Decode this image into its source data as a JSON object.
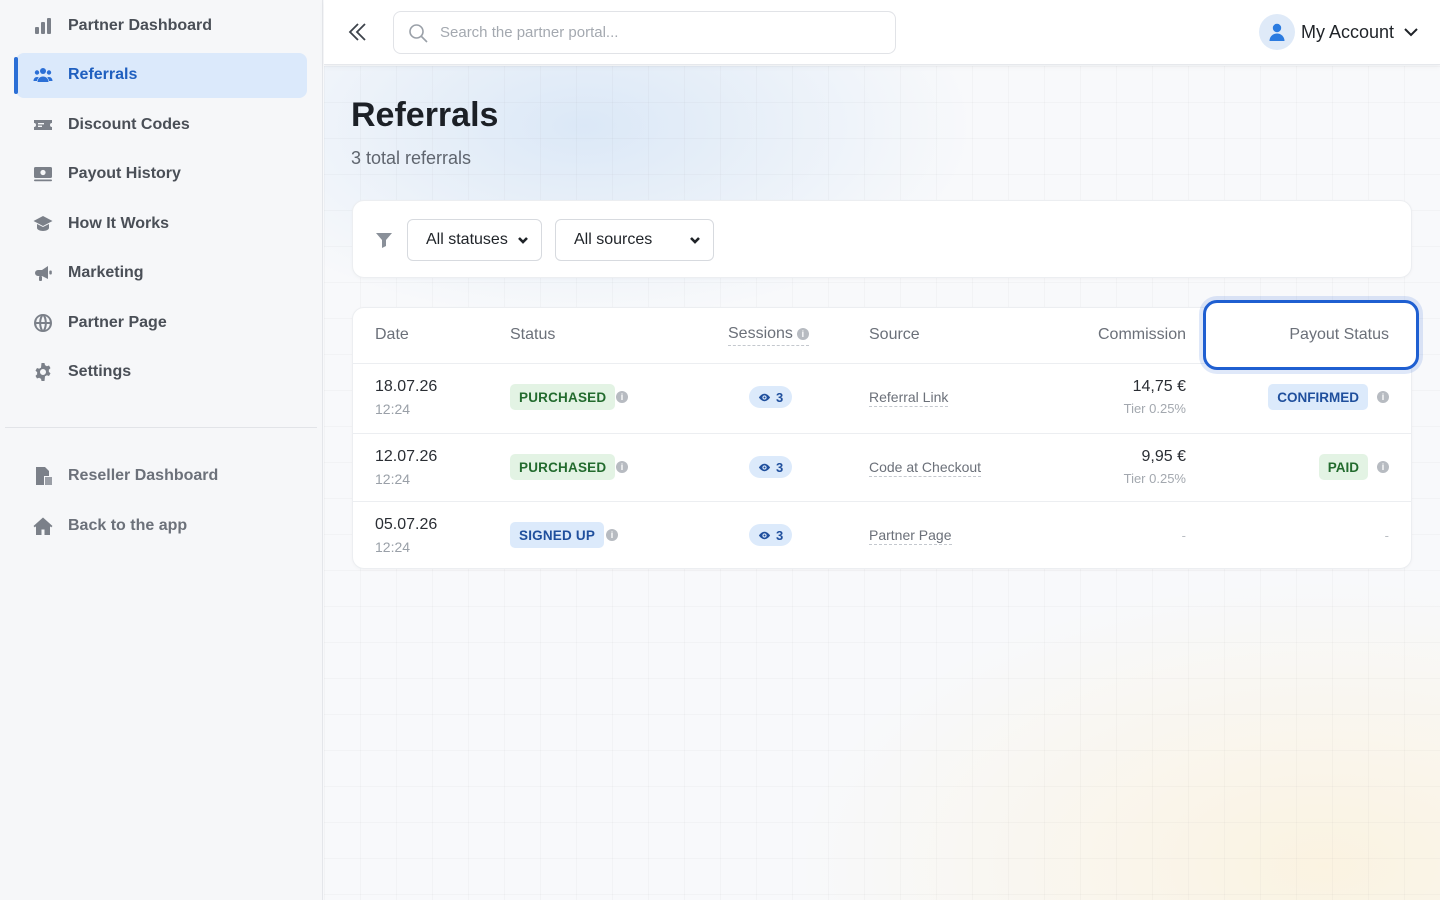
{
  "sidebar": {
    "items": [
      {
        "label": "Partner Dashboard",
        "icon": "bar-chart-icon"
      },
      {
        "label": "Referrals",
        "icon": "users-icon",
        "active": true
      },
      {
        "label": "Discount Codes",
        "icon": "ticket-icon"
      },
      {
        "label": "Payout History",
        "icon": "money-icon"
      },
      {
        "label": "How It Works",
        "icon": "graduation-cap-icon"
      },
      {
        "label": "Marketing",
        "icon": "megaphone-icon"
      },
      {
        "label": "Partner Page",
        "icon": "globe-icon"
      },
      {
        "label": "Settings",
        "icon": "gear-icon"
      }
    ],
    "secondary": [
      {
        "label": "Reseller Dashboard",
        "icon": "reseller-icon"
      },
      {
        "label": "Back to the app",
        "icon": "home-icon"
      }
    ]
  },
  "topbar": {
    "search_placeholder": "Search the partner portal...",
    "account_label": "My Account"
  },
  "page": {
    "title": "Referrals",
    "subtitle": "3 total referrals"
  },
  "filters": {
    "status": "All statuses",
    "source": "All sources"
  },
  "table": {
    "headers": {
      "date": "Date",
      "status": "Status",
      "sessions": "Sessions",
      "source": "Source",
      "commission": "Commission",
      "payout_status": "Payout Status"
    },
    "rows": [
      {
        "date": "18.07.26",
        "time": "12:24",
        "status": "PURCHASED",
        "sessions": "3",
        "source": "Referral Link",
        "commission": "14,75 €",
        "tier": "Tier 0.25%",
        "payout": "CONFIRMED"
      },
      {
        "date": "12.07.26",
        "time": "12:24",
        "status": "PURCHASED",
        "sessions": "3",
        "source": "Code at Checkout",
        "commission": "9,95 €",
        "tier": "Tier 0.25%",
        "payout": "PAID"
      },
      {
        "date": "05.07.26",
        "time": "12:24",
        "status": "SIGNED UP",
        "sessions": "3",
        "source": "Partner Page",
        "commission": "-",
        "tier": "",
        "payout": "-"
      }
    ]
  },
  "colors": {
    "accent": "#2b6fd6",
    "highlight": "#1f5fd1",
    "success_bg": "#e3f3e4",
    "info_bg": "#dceafb"
  }
}
